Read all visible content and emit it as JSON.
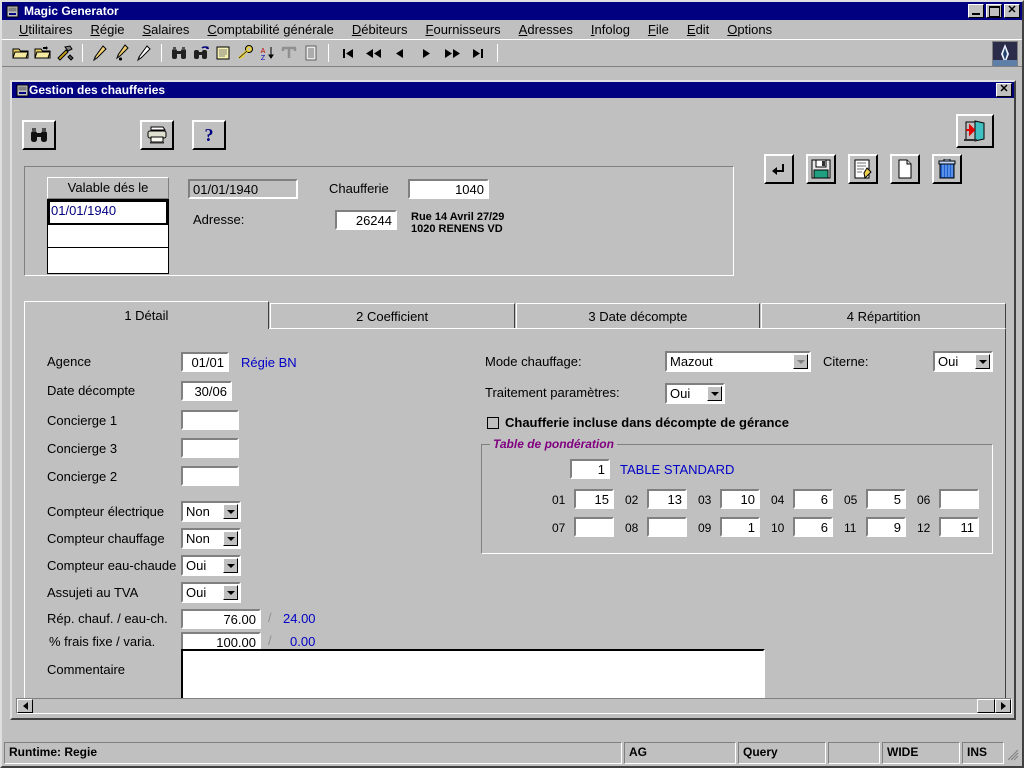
{
  "app": {
    "title": "Magic Generator",
    "icon": "app-icon",
    "sys_min": "_",
    "sys_max": "□",
    "sys_close": "✕"
  },
  "menu": {
    "items": [
      {
        "label": "Utilitaires",
        "accel": "U"
      },
      {
        "label": "Régie",
        "accel": "R"
      },
      {
        "label": "Salaires",
        "accel": "S"
      },
      {
        "label": "Comptabilité générale",
        "accel": "C"
      },
      {
        "label": "Débiteurs",
        "accel": "D"
      },
      {
        "label": "Fournisseurs",
        "accel": "F"
      },
      {
        "label": "Adresses",
        "accel": "A"
      },
      {
        "label": "Infolog",
        "accel": "I"
      },
      {
        "label": "File",
        "accel": "F"
      },
      {
        "label": "Edit",
        "accel": "E"
      },
      {
        "label": "Options",
        "accel": "O"
      }
    ]
  },
  "toolbar": {
    "buttons": [
      {
        "name": "open-folder-icon"
      },
      {
        "name": "open-folder-up-icon"
      },
      {
        "name": "tools-hammer-icon"
      },
      {
        "name": "separator"
      },
      {
        "name": "pencil-edit-icon"
      },
      {
        "name": "pencil-add-icon"
      },
      {
        "name": "pencil-plain-icon"
      },
      {
        "name": "separator"
      },
      {
        "name": "binoculars-find-icon"
      },
      {
        "name": "binoculars-find-next-icon"
      },
      {
        "name": "new-document-icon"
      },
      {
        "name": "key-icon"
      },
      {
        "name": "sort-az-icon"
      },
      {
        "name": "filter-icon"
      },
      {
        "name": "list-view-icon"
      },
      {
        "name": "separator"
      }
    ],
    "nav": [
      {
        "name": "nav-first-icon",
        "glyph": "|◀"
      },
      {
        "name": "nav-prev-page-icon",
        "glyph": "◀◀"
      },
      {
        "name": "nav-prev-icon",
        "glyph": "◀"
      },
      {
        "name": "nav-next-icon",
        "glyph": "▶"
      },
      {
        "name": "nav-next-page-icon",
        "glyph": "▶▶"
      },
      {
        "name": "nav-last-icon",
        "glyph": "▶|"
      }
    ]
  },
  "child_window": {
    "title": "Gestion des chaufferies",
    "close": "✕"
  },
  "form_toolbar": {
    "find": "binoculars-icon",
    "print": "printer-icon",
    "help": "?",
    "exit": "exit-door-icon"
  },
  "record_buttons": [
    {
      "name": "undo-button",
      "icon": "undo-arrow-icon"
    },
    {
      "name": "save-button",
      "icon": "floppy-disk-icon"
    },
    {
      "name": "edit-button",
      "icon": "edit-note-icon"
    },
    {
      "name": "new-button",
      "icon": "blank-page-icon"
    },
    {
      "name": "delete-button",
      "icon": "trash-can-icon"
    }
  ],
  "header": {
    "list_header": "Valable dés le",
    "list_rows": [
      "01/01/1940",
      "",
      ""
    ],
    "date_value": "01/01/1940",
    "chaufferie_label": "Chaufferie",
    "chaufferie_value": "1040",
    "adresse_label": "Adresse:",
    "adresse_value": "26244",
    "adresse_line1": "Rue 14 Avril 27/29",
    "adresse_line2": "1020 RENENS VD"
  },
  "tabs": [
    {
      "label": "1 Détail",
      "active": true
    },
    {
      "label": "2 Coefficient",
      "active": false
    },
    {
      "label": "3 Date décompte",
      "active": false
    },
    {
      "label": "4 Répartition",
      "active": false
    }
  ],
  "detail": {
    "agence_label": "Agence",
    "agence_value": "01/01",
    "agence_note": "Régie BN",
    "date_decompte_label": "Date décompte",
    "date_decompte_value": "30/06",
    "concierge1_label": "Concierge 1",
    "concierge1_value": "",
    "concierge3_label": "Concierge 3",
    "concierge3_value": "",
    "concierge2_label": "Concierge 2",
    "concierge2_value": "",
    "compteur_elec_label": "Compteur électrique",
    "compteur_elec_value": "Non",
    "compteur_chauf_label": "Compteur chauffage",
    "compteur_chauf_value": "Non",
    "compteur_eau_label": "Compteur eau-chaude",
    "compteur_eau_value": "Oui",
    "tva_label": "Assujeti au TVA",
    "tva_value": "Oui",
    "rep_label": "Rép. chauf. / eau-ch.",
    "rep_value": "76.00",
    "rep_sep": "/",
    "rep_second": "24.00",
    "frais_label": "% frais fixe / varia.",
    "frais_value": "100.00",
    "frais_sep": "/",
    "frais_second": "0.00",
    "commentaire_label": "Commentaire",
    "commentaire_value": ""
  },
  "right": {
    "mode_label": "Mode chauffage:",
    "mode_value": "Mazout",
    "citerne_label": "Citerne:",
    "citerne_value": "Oui",
    "traitement_label": "Traitement paramètres:",
    "traitement_value": "Oui",
    "checkbox_label": "Chaufferie incluse dans décompte de gérance",
    "checkbox_checked": false
  },
  "ponderation": {
    "title": "Table de pondération",
    "table_id": "1",
    "table_name": "TABLE STANDARD",
    "cells": [
      {
        "num": "01",
        "value": "15"
      },
      {
        "num": "02",
        "value": "13"
      },
      {
        "num": "03",
        "value": "10"
      },
      {
        "num": "04",
        "value": "6"
      },
      {
        "num": "05",
        "value": "5"
      },
      {
        "num": "06",
        "value": ""
      },
      {
        "num": "07",
        "value": ""
      },
      {
        "num": "08",
        "value": ""
      },
      {
        "num": "09",
        "value": "1"
      },
      {
        "num": "10",
        "value": "6"
      },
      {
        "num": "11",
        "value": "9"
      },
      {
        "num": "12",
        "value": "11"
      }
    ]
  },
  "statusbar": {
    "runtime": "Runtime: Regie",
    "p1": "AG",
    "p2": "Query",
    "p3": "",
    "p4": "WIDE",
    "p5": "INS"
  },
  "colors": {
    "titlebar": "#000080",
    "face": "#c0c0c0",
    "link": "#0000c8",
    "group_title": "#800080"
  }
}
